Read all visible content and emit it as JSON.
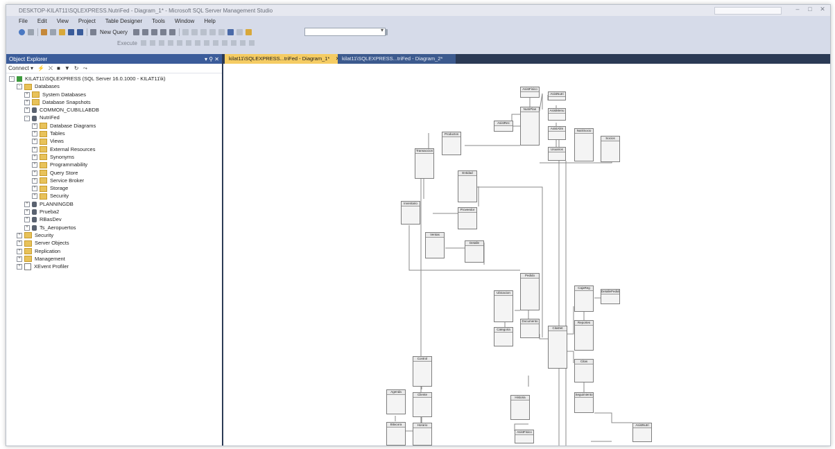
{
  "window": {
    "title": "DESKTOP-KILAT11\\SQLEXPRESS.NutriFed - Diagram_1* - Microsoft SQL Server Management Studio"
  },
  "menu": [
    "File",
    "Edit",
    "View",
    "Project",
    "Table Designer",
    "Tools",
    "Window",
    "Help"
  ],
  "toolbar": {
    "new_query_label": "New Query",
    "execute_label": "Execute"
  },
  "object_explorer": {
    "title": "Object Explorer",
    "header_controls": "▾ ⚲ ✕",
    "connect_label": "Connect ▾",
    "tree": [
      {
        "label": "KILAT11\\SQLEXPRESS (SQL Server 16.0.1000 - KILAT11\\k)",
        "depth": 0,
        "icon": "server",
        "exp": "-"
      },
      {
        "label": "Databases",
        "depth": 1,
        "icon": "folder",
        "exp": "-"
      },
      {
        "label": "System Databases",
        "depth": 2,
        "icon": "folder",
        "exp": "+"
      },
      {
        "label": "Database Snapshots",
        "depth": 2,
        "icon": "folder",
        "exp": "+"
      },
      {
        "label": "COMMON_CUBILLABDB",
        "depth": 2,
        "icon": "db",
        "exp": "+"
      },
      {
        "label": "NutriFed",
        "depth": 2,
        "icon": "db",
        "exp": "-"
      },
      {
        "label": "Database Diagrams",
        "depth": 3,
        "icon": "folder",
        "exp": "+"
      },
      {
        "label": "Tables",
        "depth": 3,
        "icon": "folder",
        "exp": "+"
      },
      {
        "label": "Views",
        "depth": 3,
        "icon": "folder",
        "exp": "+"
      },
      {
        "label": "External Resources",
        "depth": 3,
        "icon": "folder",
        "exp": "+"
      },
      {
        "label": "Synonyms",
        "depth": 3,
        "icon": "folder",
        "exp": "+"
      },
      {
        "label": "Programmability",
        "depth": 3,
        "icon": "folder",
        "exp": "+"
      },
      {
        "label": "Query Store",
        "depth": 3,
        "icon": "folder",
        "exp": "+"
      },
      {
        "label": "Service Broker",
        "depth": 3,
        "icon": "folder",
        "exp": "+"
      },
      {
        "label": "Storage",
        "depth": 3,
        "icon": "folder",
        "exp": "+"
      },
      {
        "label": "Security",
        "depth": 3,
        "icon": "folder",
        "exp": "+"
      },
      {
        "label": "PLANNINGDB",
        "depth": 2,
        "icon": "db",
        "exp": "+"
      },
      {
        "label": "Prueba2",
        "depth": 2,
        "icon": "db",
        "exp": "+"
      },
      {
        "label": "RBasDev",
        "depth": 2,
        "icon": "db",
        "exp": "+"
      },
      {
        "label": "Ts_Aeropuertos",
        "depth": 2,
        "icon": "db",
        "exp": "+"
      },
      {
        "label": "Security",
        "depth": 1,
        "icon": "folder",
        "exp": "+"
      },
      {
        "label": "Server Objects",
        "depth": 1,
        "icon": "folder",
        "exp": "+"
      },
      {
        "label": "Replication",
        "depth": 1,
        "icon": "folder",
        "exp": "+"
      },
      {
        "label": "Management",
        "depth": 1,
        "icon": "folder",
        "exp": "+"
      },
      {
        "label": "XEvent Profiler",
        "depth": 1,
        "icon": "xevent",
        "exp": "+"
      }
    ]
  },
  "tabs": {
    "active": {
      "label": "kilat11\\SQLEXPRESS...triFed - Diagram_1*",
      "close": "✕"
    },
    "inactive": {
      "label": "kilat11\\SQLEXPRESS...triFed - Diagram_2*"
    }
  },
  "diagram": {
    "tables": [
      "AsistFisico",
      "AsistNutri",
      "NutriPlan",
      "AsistRec",
      "AsistMenu",
      "NutriSocio",
      "Socios",
      "AsistAlim",
      "Usuarios",
      "Transaccion",
      "Productos",
      "Entidad",
      "Inventario",
      "Proveedor",
      "Ventas",
      "Detalle",
      "Pedido",
      "Ubicacion",
      "Documento",
      "Categoria",
      "DetallePedido",
      "CajaReg",
      "Reportes",
      "CitaDet",
      "Citas",
      "Seguimiento",
      "Control",
      "Historia",
      "Agenda",
      "Cliente",
      "Bitacora",
      "Horario"
    ]
  }
}
